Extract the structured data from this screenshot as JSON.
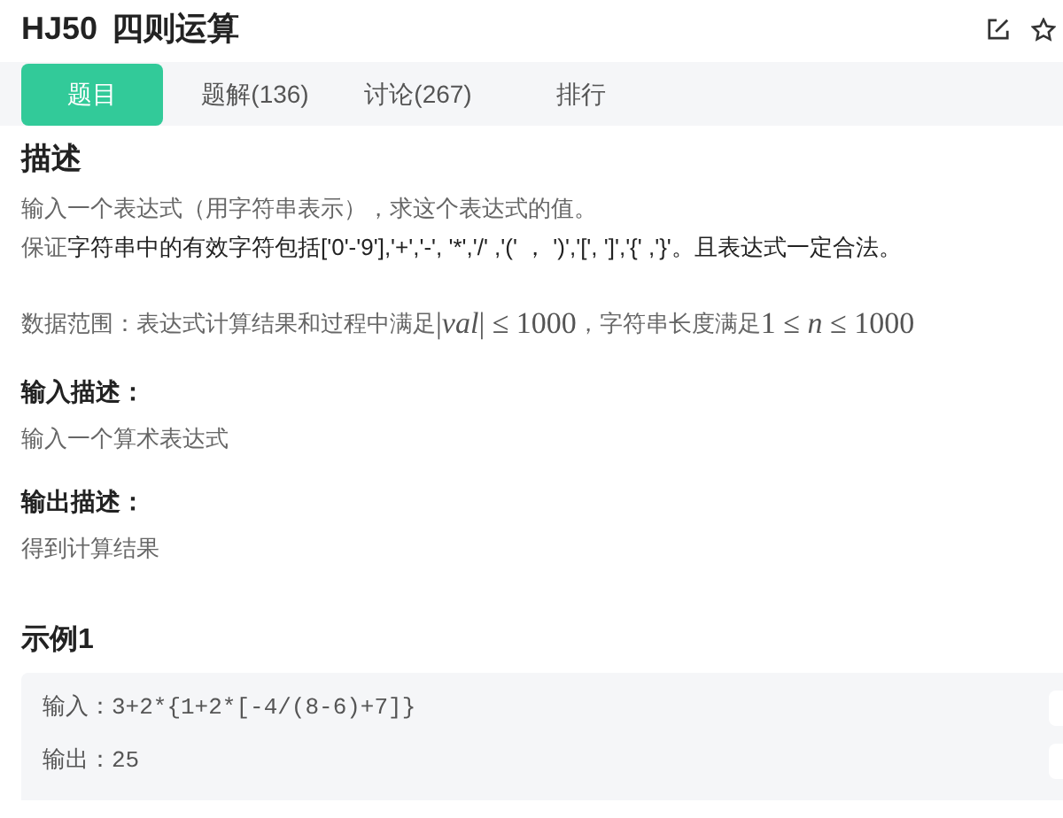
{
  "title": {
    "code": "HJ50",
    "name": "四则运算"
  },
  "tabs": [
    {
      "label": "题目",
      "selected": true
    },
    {
      "label": "题解(136)",
      "selected": false
    },
    {
      "label": "讨论(267)",
      "selected": false
    },
    {
      "label": "排行",
      "selected": false
    }
  ],
  "description": {
    "heading": "描述",
    "paragraphs": [
      [
        {
          "kind": "text",
          "text": "输入一个表达式（用字符串表示），求这个表达式的值。",
          "dark": false
        }
      ],
      [
        {
          "kind": "text",
          "text": "保证",
          "dark": false
        },
        {
          "kind": "text",
          "text": "字符串中的有效字符包括['0'-'9'],'+','-', '*','/' ,'(' ， ')','[', ']','{' ,'}'。且表达式一定合法。",
          "dark": true
        }
      ],
      [
        {
          "kind": "text",
          "text": "数据范围：表达式计算结果和过程中满足 ",
          "dark": false
        },
        {
          "kind": "math",
          "text": "|*val*| ≤ 1000"
        },
        {
          "kind": "text",
          "text": " ，字符串长度满足 ",
          "dark": false
        },
        {
          "kind": "math",
          "text": "1 ≤ *n* ≤ 1000"
        }
      ]
    ]
  },
  "input_description": {
    "heading": "输入描述：",
    "text": "输入一个算术表达式"
  },
  "output_description": {
    "heading": "输出描述：",
    "text": "得到计算结果"
  },
  "example": {
    "heading": "示例1",
    "lines": [
      {
        "label": "输入：",
        "value": "3+2*{1+2*[-4/(8-6)+7]}"
      },
      {
        "label": "输出：",
        "value": "25"
      }
    ]
  }
}
